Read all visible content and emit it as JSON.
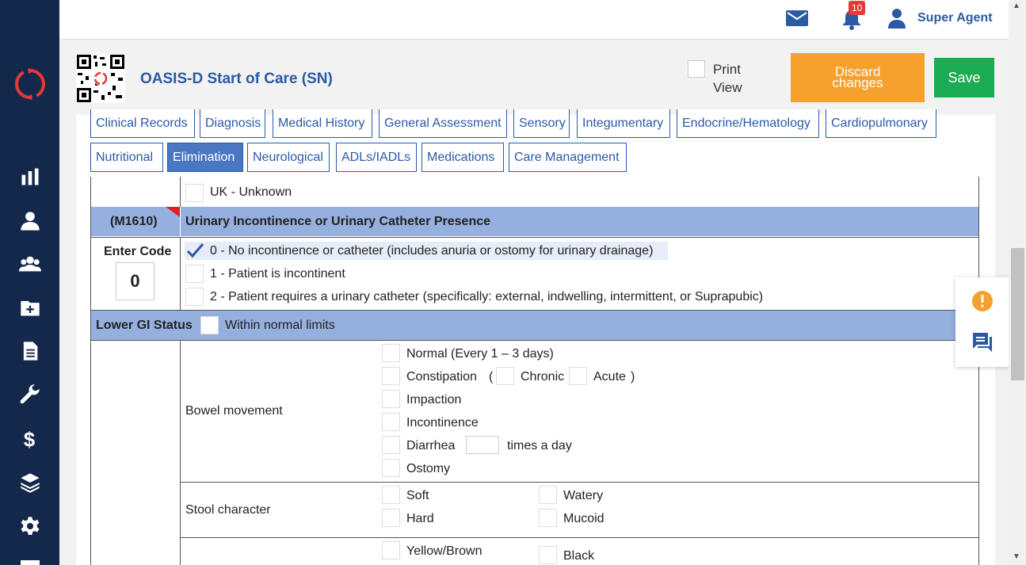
{
  "topbar": {
    "notification_count": "10",
    "username": "Super Agent"
  },
  "header": {
    "title": "OASIS-D Start of Care (SN)",
    "print_view_line1": "Print",
    "print_view_line2": "View",
    "discard_line1": "Discard",
    "discard_line2": "changes",
    "save_label": "Save"
  },
  "tabs": {
    "row1": [
      "Clinical Records",
      "Diagnosis",
      "Medical History",
      "General Assessment",
      "Sensory",
      "Integumentary",
      "Endocrine/Hematology",
      "Cardiopulmonary"
    ],
    "row2": [
      "Nutritional",
      "Elimination",
      "Neurological",
      "ADLs/IADLs",
      "Medications",
      "Care Management"
    ],
    "active": "Elimination"
  },
  "form": {
    "uk_option": "UK - Unknown",
    "m1610": {
      "code": "(M1610)",
      "title": "Urinary Incontinence or Urinary Catheter Presence",
      "enter_code_label": "Enter Code",
      "entered_value": "0",
      "options": [
        "0 - No incontinence or catheter (includes anuria or ostomy for urinary drainage)",
        "1 - Patient is incontinent",
        "2 - Patient requires a urinary catheter (specifically: external, indwelling, intermittent, or Suprapubic)"
      ],
      "selected_index": 0
    },
    "lower_gi": {
      "label": "Lower GI Status",
      "wnl_label": "Within normal limits"
    },
    "bowel": {
      "label": "Bowel movement",
      "normal": "Normal (Every 1 – 3 days)",
      "constipation": "Constipation",
      "open_paren": "(",
      "chronic": "Chronic",
      "acute": "Acute",
      "close_paren": ")",
      "impaction": "Impaction",
      "incontinence": "Incontinence",
      "diarrhea": "Diarrhea",
      "times_a_day": "times a day",
      "ostomy": "Ostomy"
    },
    "stool": {
      "label": "Stool character",
      "soft": "Soft",
      "watery": "Watery",
      "hard": "Hard",
      "mucoid": "Mucoid"
    },
    "color": {
      "yellow_brown": "Yellow/Brown",
      "black": "Black"
    }
  },
  "colors": {
    "sidebar": "#14284b",
    "accent_blue": "#2b5aa5",
    "section_band": "#95b0df",
    "discard": "#f6a12d",
    "save": "#1aab53"
  }
}
